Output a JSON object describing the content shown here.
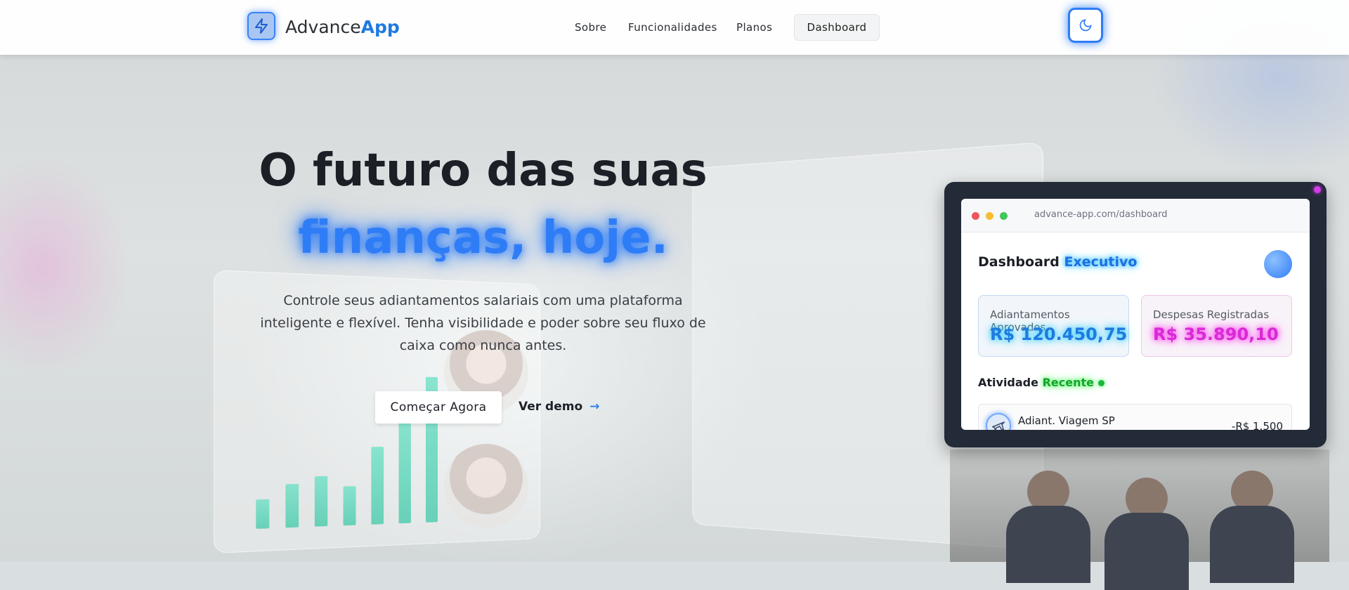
{
  "brand": {
    "name_prefix": "Advance",
    "name_suffix": "App"
  },
  "nav": {
    "links": [
      "Sobre",
      "Funcionalidades",
      "Planos"
    ],
    "dashboard_button": "Dashboard"
  },
  "hero": {
    "title_line1": "O futuro das suas",
    "title_line2": "finanças, hoje.",
    "subtitle": "Controle seus adiantamentos salariais com uma plataforma inteligente e flexível. Tenha visibilidade e poder sobre seu fluxo de caixa como nunca antes.",
    "primary_button": "Começar Agora",
    "secondary_button": "Ver demo",
    "secondary_arrow": "→"
  },
  "dashboard_preview": {
    "url": "advance-app.com/dashboard",
    "title_prefix": "Dashboard",
    "title_highlight": "Executivo",
    "stats": [
      {
        "label": "Adiantamentos Aprovados",
        "value": "R$ 120.450,75"
      },
      {
        "label": "Despesas Registradas",
        "value": "R$ 35.890,10"
      }
    ],
    "activity_prefix": "Atividade",
    "activity_highlight": "Recente",
    "activity_items": [
      {
        "name": "Adiant. Viagem SP",
        "amount": "-R$ 1.500",
        "icon": "airplane-icon"
      }
    ]
  },
  "colors": {
    "accent": "#2f7df6",
    "cyan_glow": "#3fd1ff",
    "magenta_glow": "#ff4cf0",
    "green_glow": "#5cff6a",
    "dark_card": "#232a38"
  },
  "icons": {
    "logo": "lightning-icon",
    "theme_toggle": "moon-icon"
  }
}
